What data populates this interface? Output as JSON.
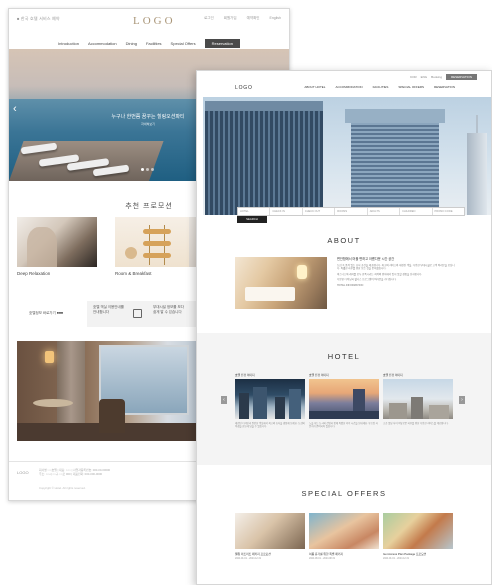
{
  "resort_site": {
    "logo": "LOGO",
    "util_left": "■ 한국 호텔 서비스 예약",
    "util_right": [
      "로그인",
      "회원가입",
      "예약확인",
      "English"
    ],
    "nav": [
      "Introduction",
      "Accommodation",
      "Dining",
      "Facilities",
      "Special Offers"
    ],
    "reservation_label": "Reservation",
    "hero_caption": "누구나 한번쯤 꿈꾸는 힐링오션파티",
    "hero_sub": "자세히보기",
    "promo_title": "추천 프로모션",
    "promo_labels": [
      "Deep Relaxation",
      "Room & Breakfast"
    ],
    "info_left": "호텔정보 바로가기 ■■■",
    "info_mid": [
      "호텔 객실 이용안내를",
      "안내합니다"
    ],
    "info_right": [
      "부대시설 정보를 보다",
      "쉽게 알 수 있습니다"
    ],
    "footer_logo": "LOGO",
    "footer_text": [
      "회사명: ○○호텔 | 대표: ○○○ | 사업자등록번호: 000-00-00000",
      "주소: ○○시 ○○구 ○○로 000 | 대표전화: 000-000-0000"
    ],
    "footer_right": "■ 패밀리사이트",
    "footer_bottom": "Copyright © Hotel. All rights reserved."
  },
  "hotel_site": {
    "logo": "LOGO",
    "util": [
      "KOR",
      "ENG",
      "Booking"
    ],
    "util_dark": "RESERVATION",
    "nav": [
      "ABOUT HOTEL",
      "ACCOMMODATION",
      "FACILITIES",
      "SPECIAL OFFERS",
      "RESERVATION"
    ],
    "search_fields": [
      "HOTEL",
      "CHECK IN",
      "CHECK OUT",
      "ROOMS",
      "ADULTS",
      "CHILDREN",
      "PROMO CODE"
    ],
    "search_button": "SEARCH",
    "about_title": "ABOUT",
    "about_lead": "편안함에서 머물 편하고 아름다운 시간 공간",
    "about_paragraphs": [
      "도심 속 품격 있는 휴식 공간을 제공합니다. 최고의 서비스와 세련된 객실, 다양한 부대시설로 고객 여러분을 모십니다. 특별한 하루를 위한 모든 것을 준비했습니다.",
      "비즈니스와 레저를 모두 만족시키는 최적의 위치에서 잊지 못할 경험을 선사합니다.",
      "다양한 다이닝과 웰니스 프로그램이 여러분을 기다립니다.",
      "HOTEL INFORMATION"
    ],
    "hotel_title": "HOTEL",
    "hotel_cards": [
      {
        "caption": "호텔 전경 이미지",
        "text": "세련된 디자인과 편안한 객실에서 최고의 휴식을 경험해 보세요. 도심의 야경을 한눈에 담을 수 있습니다."
      },
      {
        "caption": "호텔 전경 이미지",
        "text": "노을 지는 도시의 전망과 함께 특별한 저녁 시간을 보내세요. 루프탑 라운지가 준비되어 있습니다."
      },
      {
        "caption": "호텔 전경 이미지",
        "text": "고층 빌딩 사이 여유로운 하루를 위한 다양한 서비스를 제공합니다."
      }
    ],
    "offers_title": "SPECIAL OFFERS",
    "offer_cards": [
      {
        "title": "웰컴 리트리트 패키지 프로모션",
        "desc": "2024.01.01 - 2024.12.31"
      },
      {
        "title": "여름 휴가를 위한 특별 패키지",
        "desc": "2024.06.01 - 2024.08.31"
      },
      {
        "title": "Get Access Plan Package 프로모션",
        "desc": "2024.01.01 - 2024.12.31"
      }
    ]
  }
}
